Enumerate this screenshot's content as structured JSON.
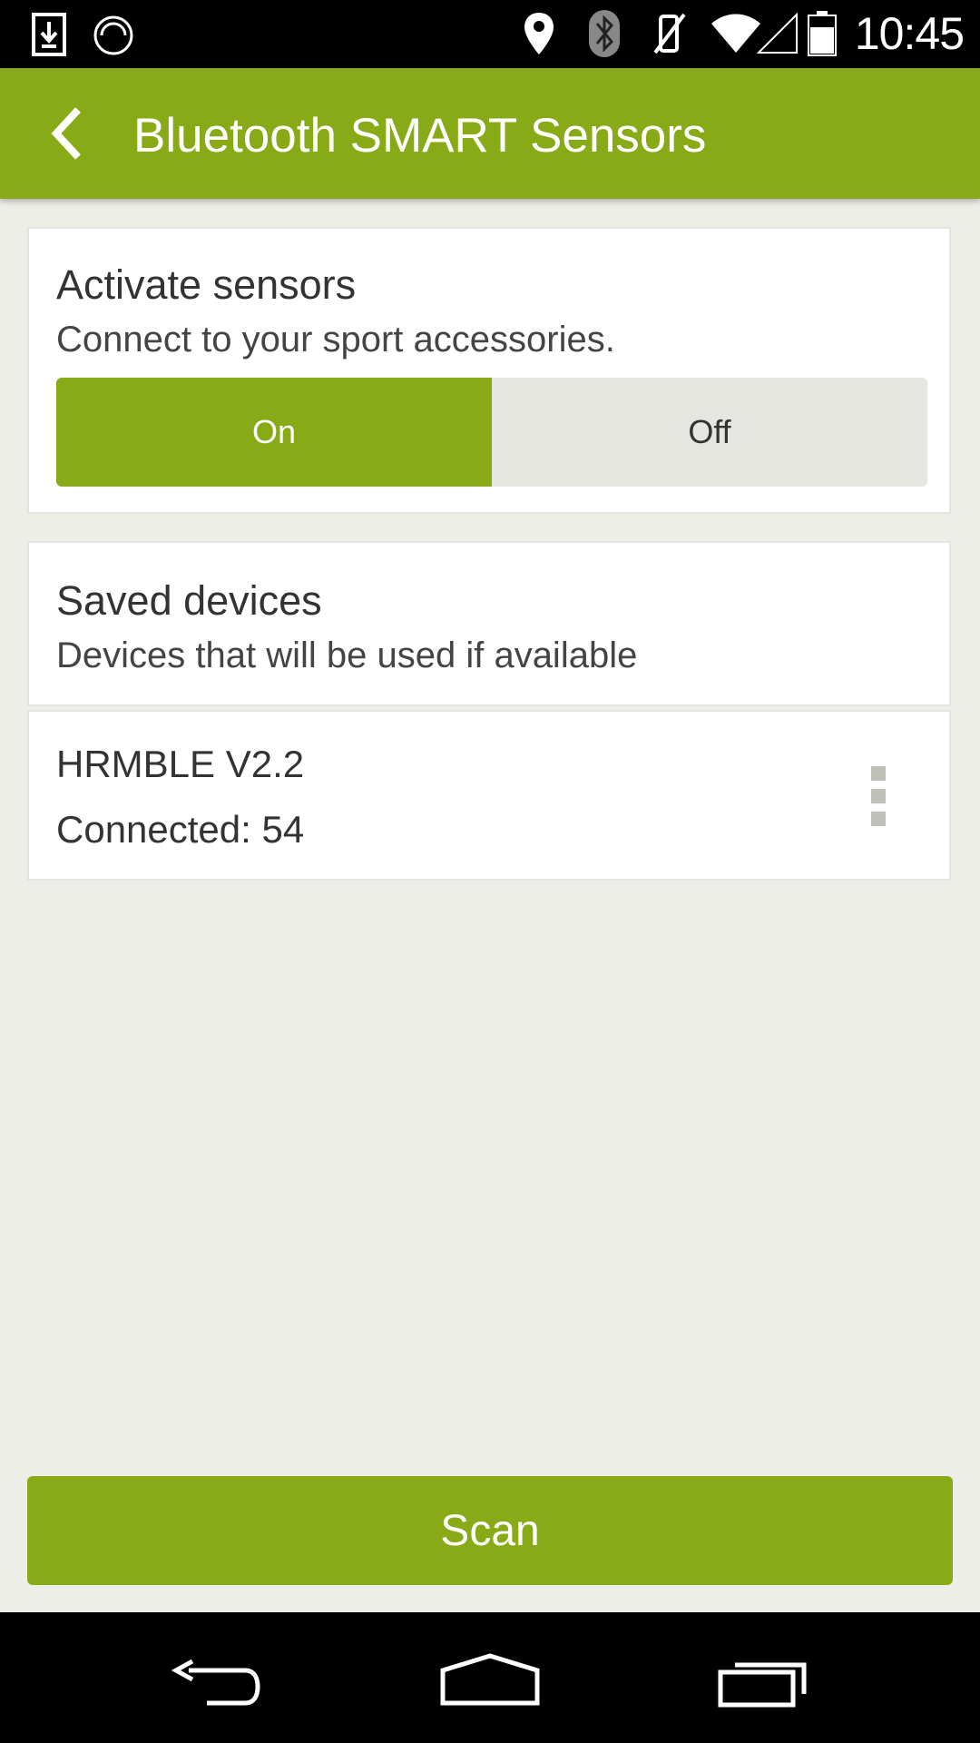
{
  "status_bar": {
    "time": "10:45",
    "icons": [
      "download-icon",
      "sync-icon",
      "location-icon",
      "bluetooth-icon",
      "vibrate-off-icon",
      "wifi-icon",
      "signal-icon",
      "battery-icon"
    ]
  },
  "app_bar": {
    "back_icon": "chevron-left-icon",
    "title": "Bluetooth SMART Sensors"
  },
  "activate": {
    "title": "Activate sensors",
    "subtitle": "Connect to your sport accessories.",
    "on_label": "On",
    "off_label": "Off",
    "selected": "On"
  },
  "saved": {
    "title": "Saved devices",
    "subtitle": "Devices that will be used if available"
  },
  "devices": [
    {
      "name": "HRMBLE V2.2",
      "status": "Connected:  54"
    }
  ],
  "scan_label": "Scan",
  "colors": {
    "accent": "#89aa17",
    "toggle_off": "#e6e6e1",
    "background": "#eeeee9"
  }
}
